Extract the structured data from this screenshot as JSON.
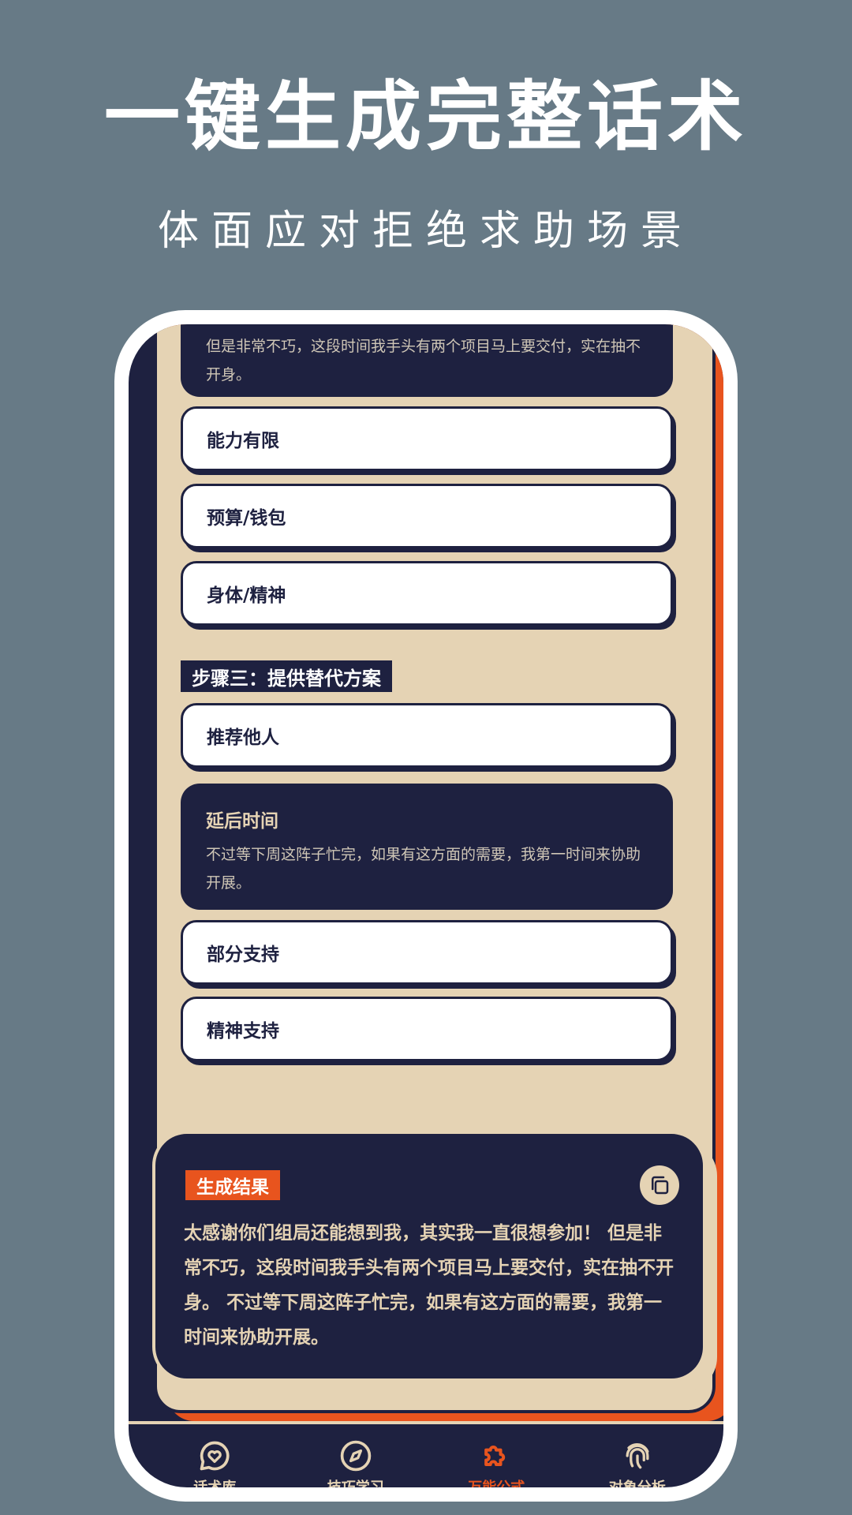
{
  "promo": {
    "headline": "一键生成完整话术",
    "subline": "体面应对拒绝求助场景"
  },
  "card": {
    "top_option_desc": "但是非常不巧，这段时间我手头有两个项目马上要交付，实在抽不开身。",
    "options_group_1": [
      "能力有限",
      "预算/钱包",
      "身体/精神"
    ],
    "step3_label": "步骤三：提供替代方案",
    "options_group_2": {
      "recommend": "推荐他人",
      "delay_title": "延后时间",
      "delay_desc": "不过等下周这阵子忙完，如果有这方面的需要，我第一时间来协助开展。",
      "partial": "部分支持",
      "spiritual": "精神支持"
    }
  },
  "result": {
    "tag": "生成结果",
    "text": "太感谢你们组局还能想到我，其实我一直很想参加！ 但是非常不巧，这段时间我手头有两个项目马上要交付，实在抽不开身。 不过等下周这阵子忙完，如果有这方面的需要，我第一时间来协助开展。",
    "copy_icon": "copy-icon"
  },
  "tabbar": {
    "tabs": [
      {
        "label": "话术库",
        "icon": "chat-heart-icon",
        "active": false
      },
      {
        "label": "技巧学习",
        "icon": "compass-icon",
        "active": false
      },
      {
        "label": "万能公式",
        "icon": "puzzle-icon",
        "active": true
      },
      {
        "label": "对象分析",
        "icon": "fingerprint-icon",
        "active": false
      }
    ]
  },
  "colors": {
    "background": "#677a86",
    "navy": "#1e2140",
    "cream": "#e5d3b4",
    "accent": "#e8541e"
  }
}
